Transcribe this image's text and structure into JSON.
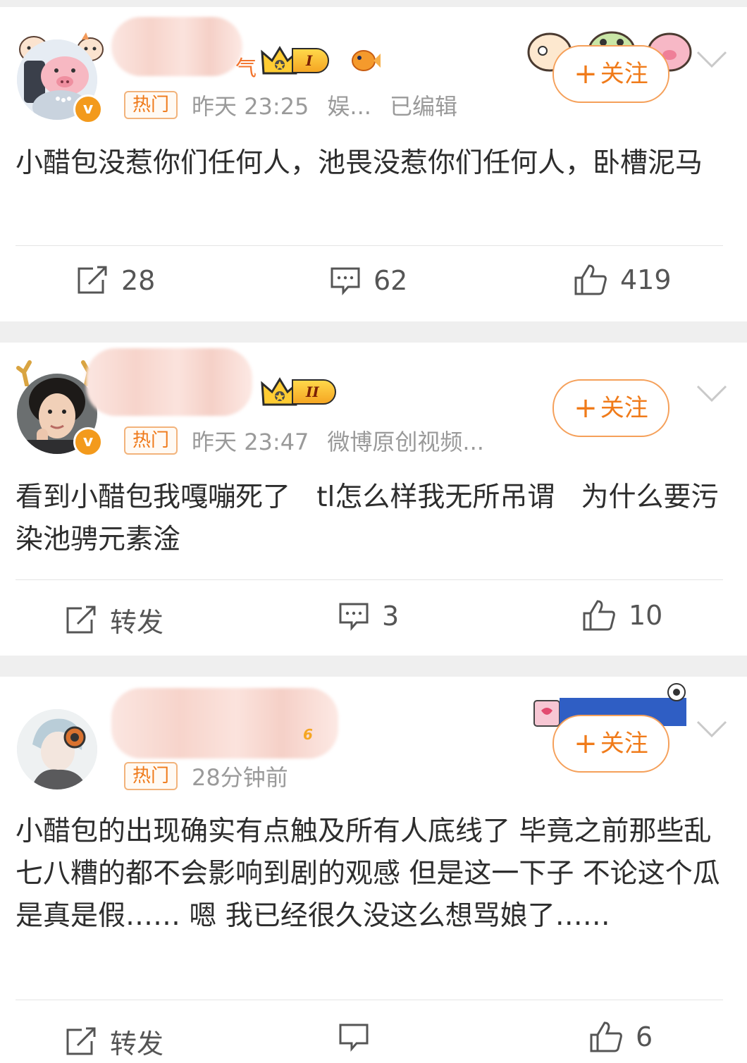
{
  "colors": {
    "accent": "#f07b1a",
    "hot_border": "#f2b37b",
    "meta": "#9a9a9a",
    "text": "#2d2d2d",
    "separator": "#efefef"
  },
  "posts": [
    {
      "name_visible_fragment": "气",
      "level_label": "I",
      "hot_label": "热门",
      "time": "昨天 23:25",
      "source": "娱...",
      "edited": "已编辑",
      "follow_label": "关注",
      "content": "小醋包没惹你们任何人，池畏没惹你们任何人，卧槽泥马",
      "actions": {
        "repost": "28",
        "comment": "62",
        "like": "419"
      },
      "icons": [
        "share-icon",
        "comment-icon",
        "like-icon"
      ]
    },
    {
      "level_label": "II",
      "hot_label": "热门",
      "time": "昨天 23:47",
      "source": "微博原创视频...",
      "follow_label": "关注",
      "content": "看到小醋包我嘎嘣死了   tl怎么样我无所吊谓   为什么要污染池骋元素淦",
      "actions": {
        "repost": "转发",
        "comment": "3",
        "like": "10"
      }
    },
    {
      "level_label": "6",
      "hot_label": "热门",
      "time": "28分钟前",
      "follow_label": "关注",
      "content": "小醋包的出现确实有点触及所有人底线了 毕竟之前那些乱七八糟的都不会影响到剧的观感 但是这一下子 不论这个瓜是真是假…… 嗯 我已经很久没这么想骂娘了……",
      "actions": {
        "repost": "转发",
        "comment": "",
        "like": "6"
      }
    }
  ]
}
